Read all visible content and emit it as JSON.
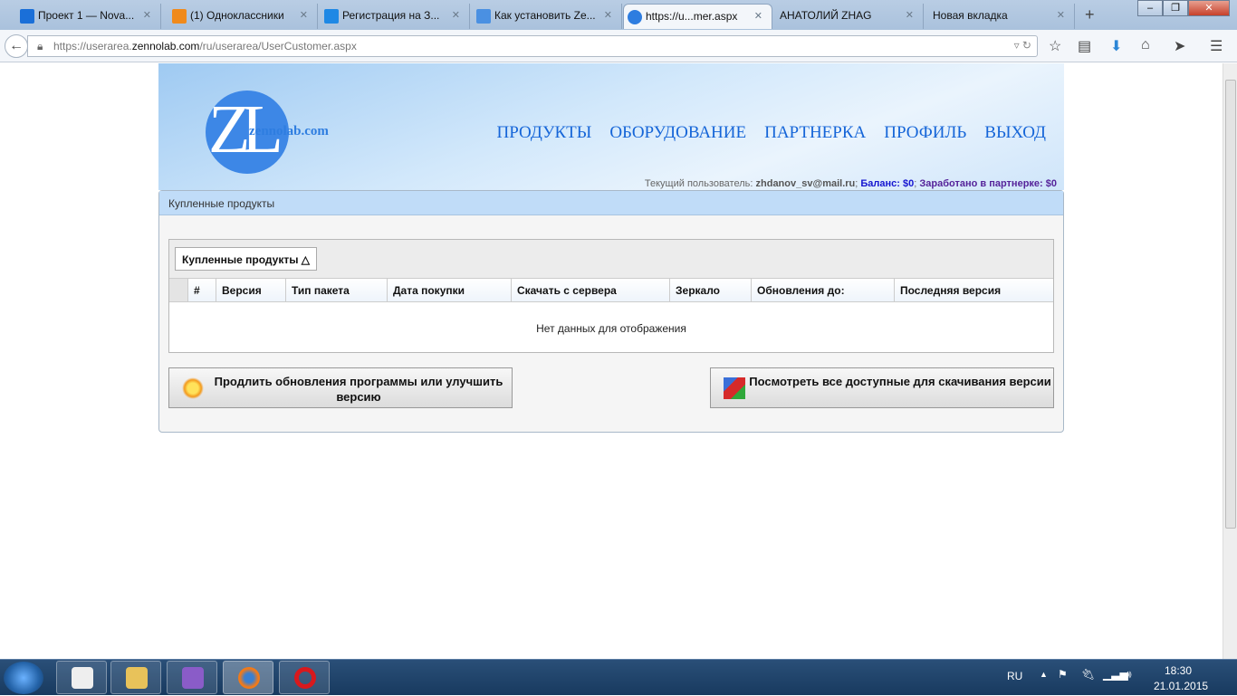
{
  "browser": {
    "tabs": [
      {
        "title": "Проект 1 — Nova...",
        "color": "#1a6fd8"
      },
      {
        "title": "(1) Одноклассники",
        "color": "#f08a1c"
      },
      {
        "title": "Регистрация на З...",
        "color": "#1e88e5"
      },
      {
        "title": "Как установить Ze...",
        "color": "#4a90e2"
      },
      {
        "title": "https://u...mer.aspx",
        "color": "#2e7de0",
        "active": true
      },
      {
        "title": "АНАТОЛИЙ ZHAG",
        "color": ""
      },
      {
        "title": "Новая вкладка",
        "color": ""
      }
    ],
    "new_tab": "+",
    "url_prefix": "https://userarea.",
    "url_domain": "zennolab.com",
    "url_suffix": "/ru/userarea/UserCustomer.aspx"
  },
  "site": {
    "logo_mark": "ZL",
    "logo_text": "zennolab.com",
    "menu": [
      "ПРОДУКТЫ",
      "ОБОРУДОВАНИЕ",
      "ПАРТНЕРКА",
      "ПРОФИЛЬ",
      "ВЫХОД"
    ],
    "user_label": "Текущий пользователь:",
    "user_email": "zhdanov_sv@mail.ru",
    "balance": "Баланс: $0",
    "earned": "Заработано в партнерке: $0"
  },
  "panel": {
    "title": "Купленные продукты",
    "group_chip": "Купленные продукты △",
    "columns": [
      "",
      "#",
      "Версия",
      "Тип пакета",
      "Дата покупки",
      "Скачать с сервера",
      "Зеркало",
      "Обновления до:",
      "Последняя версия"
    ],
    "empty_text": "Нет данных для отображения",
    "button_renew": "Продлить обновления программы или улучшить версию",
    "button_versions": "Посмотреть все доступные для скачивания версии"
  },
  "taskbar": {
    "lang": "RU",
    "time": "18:30",
    "date": "21.01.2015"
  }
}
